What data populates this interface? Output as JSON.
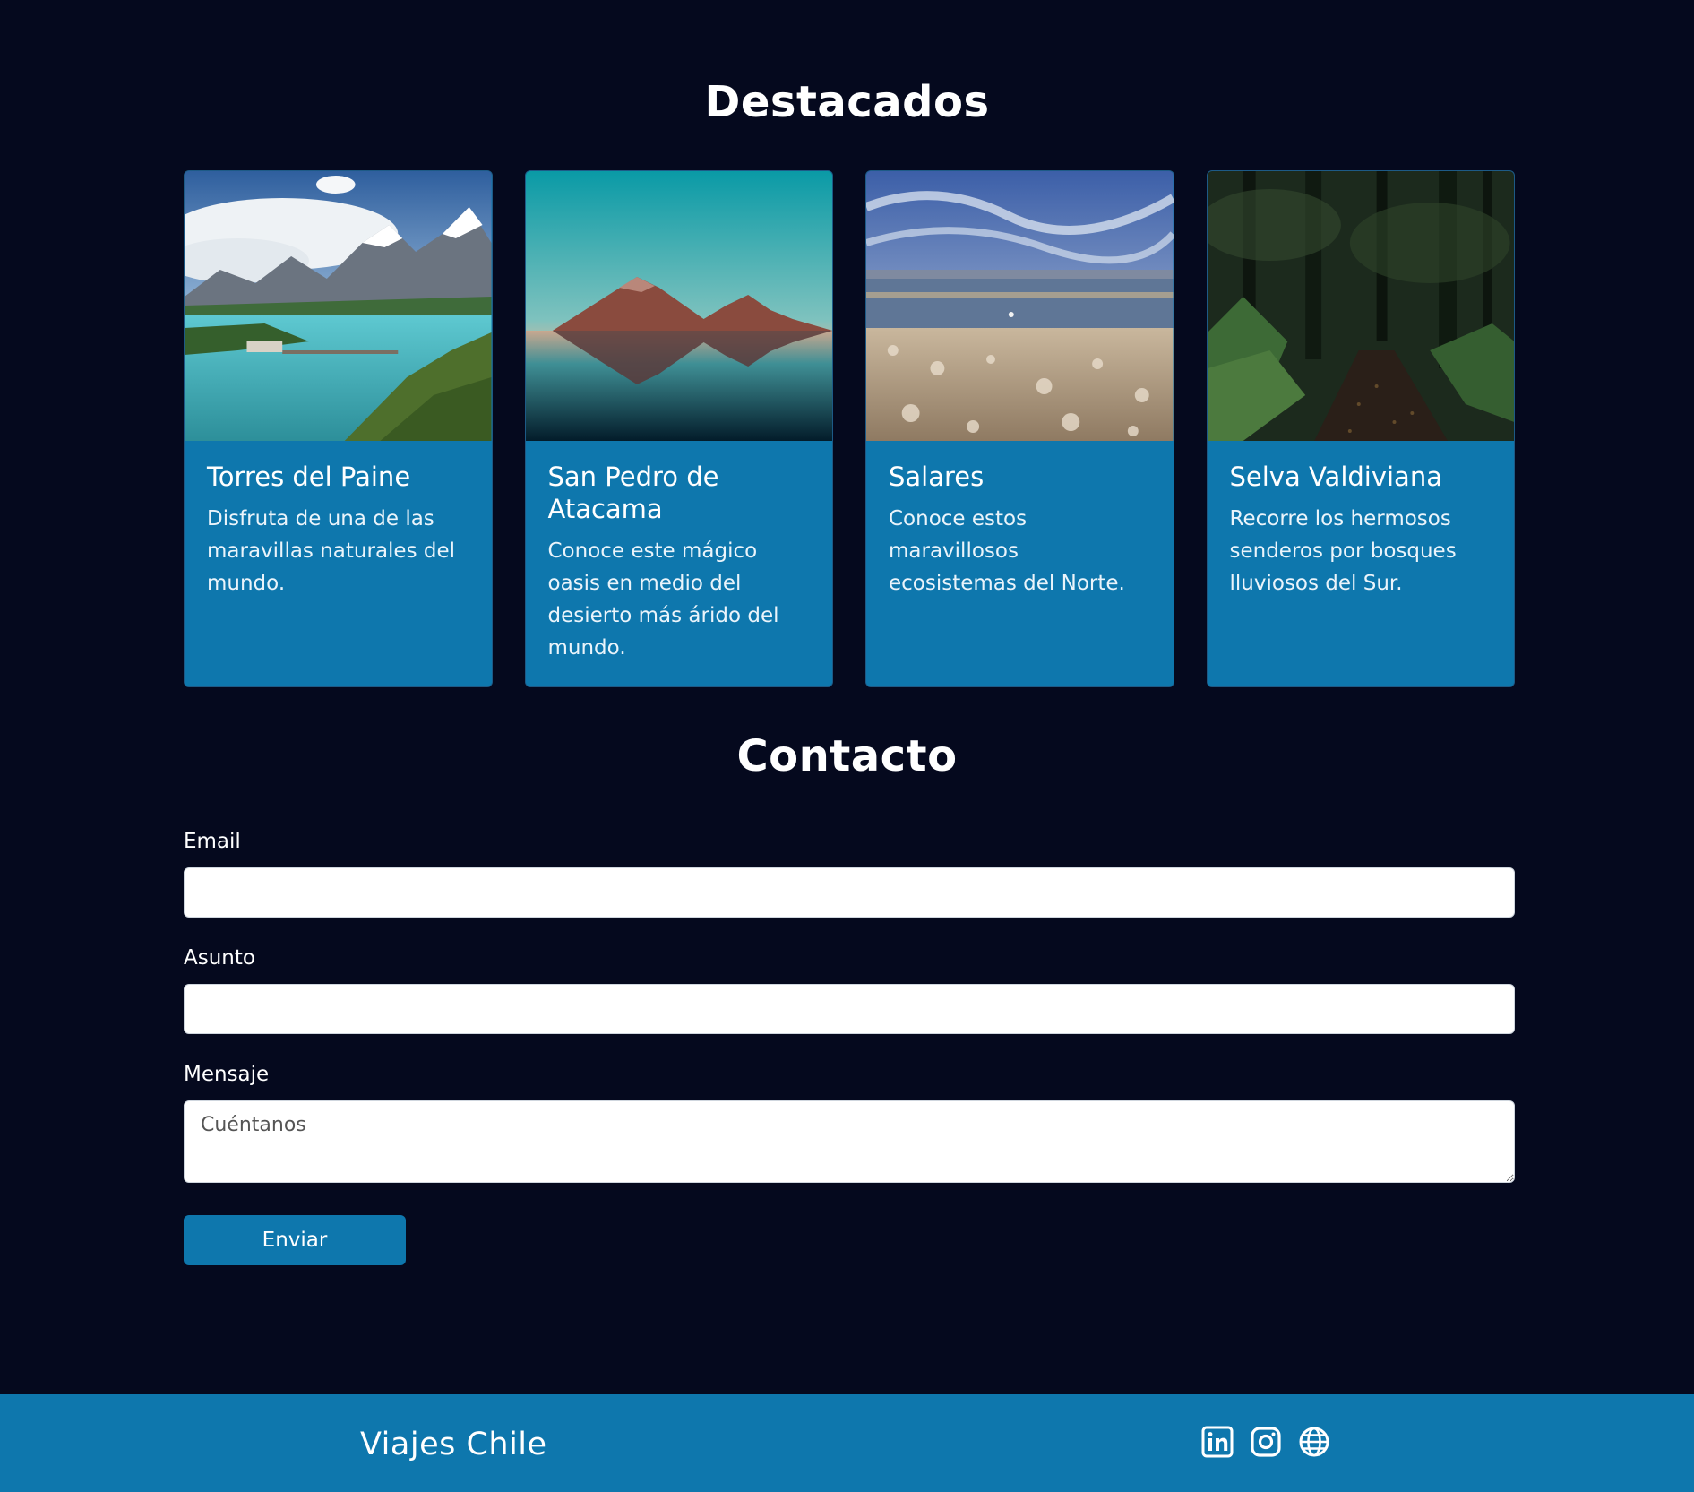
{
  "featured": {
    "title": "Destacados",
    "cards": [
      {
        "title": "Torres del Paine",
        "text": "Disfruta de una de las maravillas naturales del mundo.",
        "image": "mountain-lake-photo"
      },
      {
        "title": "San Pedro de Atacama",
        "text": "Conoce este mágico oasis en medio del desierto más árido del mundo.",
        "image": "volcano-reflection-photo"
      },
      {
        "title": "Salares",
        "text": "Conoce estos maravillosos ecosistemas del Norte.",
        "image": "salt-flat-photo"
      },
      {
        "title": "Selva Valdiviana",
        "text": "Recorre los hermosos senderos por bosques lluviosos del Sur.",
        "image": "rainforest-trail-photo"
      }
    ]
  },
  "contact": {
    "title": "Contacto",
    "email_label": "Email",
    "email_value": "",
    "subject_label": "Asunto",
    "subject_value": "",
    "message_label": "Mensaje",
    "message_placeholder": "Cuéntanos",
    "submit_label": "Enviar"
  },
  "footer": {
    "brand": "Viajes Chile",
    "social_icons": [
      "linkedin-icon",
      "instagram-icon",
      "globe-icon"
    ]
  },
  "colors": {
    "background": "#05091e",
    "accent": "#0e77ad",
    "text": "#ffffff"
  }
}
